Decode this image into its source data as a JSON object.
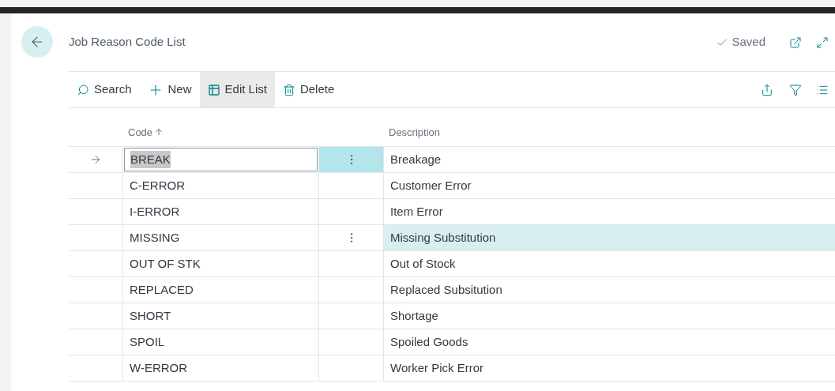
{
  "page": {
    "title": "Job Reason Code List",
    "status": "Saved"
  },
  "actions": [
    {
      "kind": "search",
      "label": "Search",
      "active": false
    },
    {
      "kind": "new",
      "label": "New",
      "active": false
    },
    {
      "kind": "edit",
      "label": "Edit List",
      "active": true
    },
    {
      "kind": "delete",
      "label": "Delete",
      "active": false
    }
  ],
  "table": {
    "columns": [
      {
        "label": "Code",
        "sorted": true
      },
      {
        "label": "Description",
        "sorted": false
      }
    ],
    "rows": [
      {
        "code": "BREAK",
        "description": "Breakage",
        "selected": true,
        "hovered": false
      },
      {
        "code": "C-ERROR",
        "description": "Customer Error",
        "selected": false,
        "hovered": false
      },
      {
        "code": "I-ERROR",
        "description": "Item Error",
        "selected": false,
        "hovered": false
      },
      {
        "code": "MISSING",
        "description": "Missing Substitution",
        "selected": false,
        "hovered": true
      },
      {
        "code": "OUT OF STK",
        "description": "Out of Stock",
        "selected": false,
        "hovered": false
      },
      {
        "code": "REPLACED",
        "description": "Replaced Subsitution",
        "selected": false,
        "hovered": false
      },
      {
        "code": "SHORT",
        "description": "Shortage",
        "selected": false,
        "hovered": false
      },
      {
        "code": "SPOIL",
        "description": "Spoiled Goods",
        "selected": false,
        "hovered": false
      },
      {
        "code": "W-ERROR",
        "description": "Worker Pick Error",
        "selected": false,
        "hovered": false
      }
    ]
  }
}
